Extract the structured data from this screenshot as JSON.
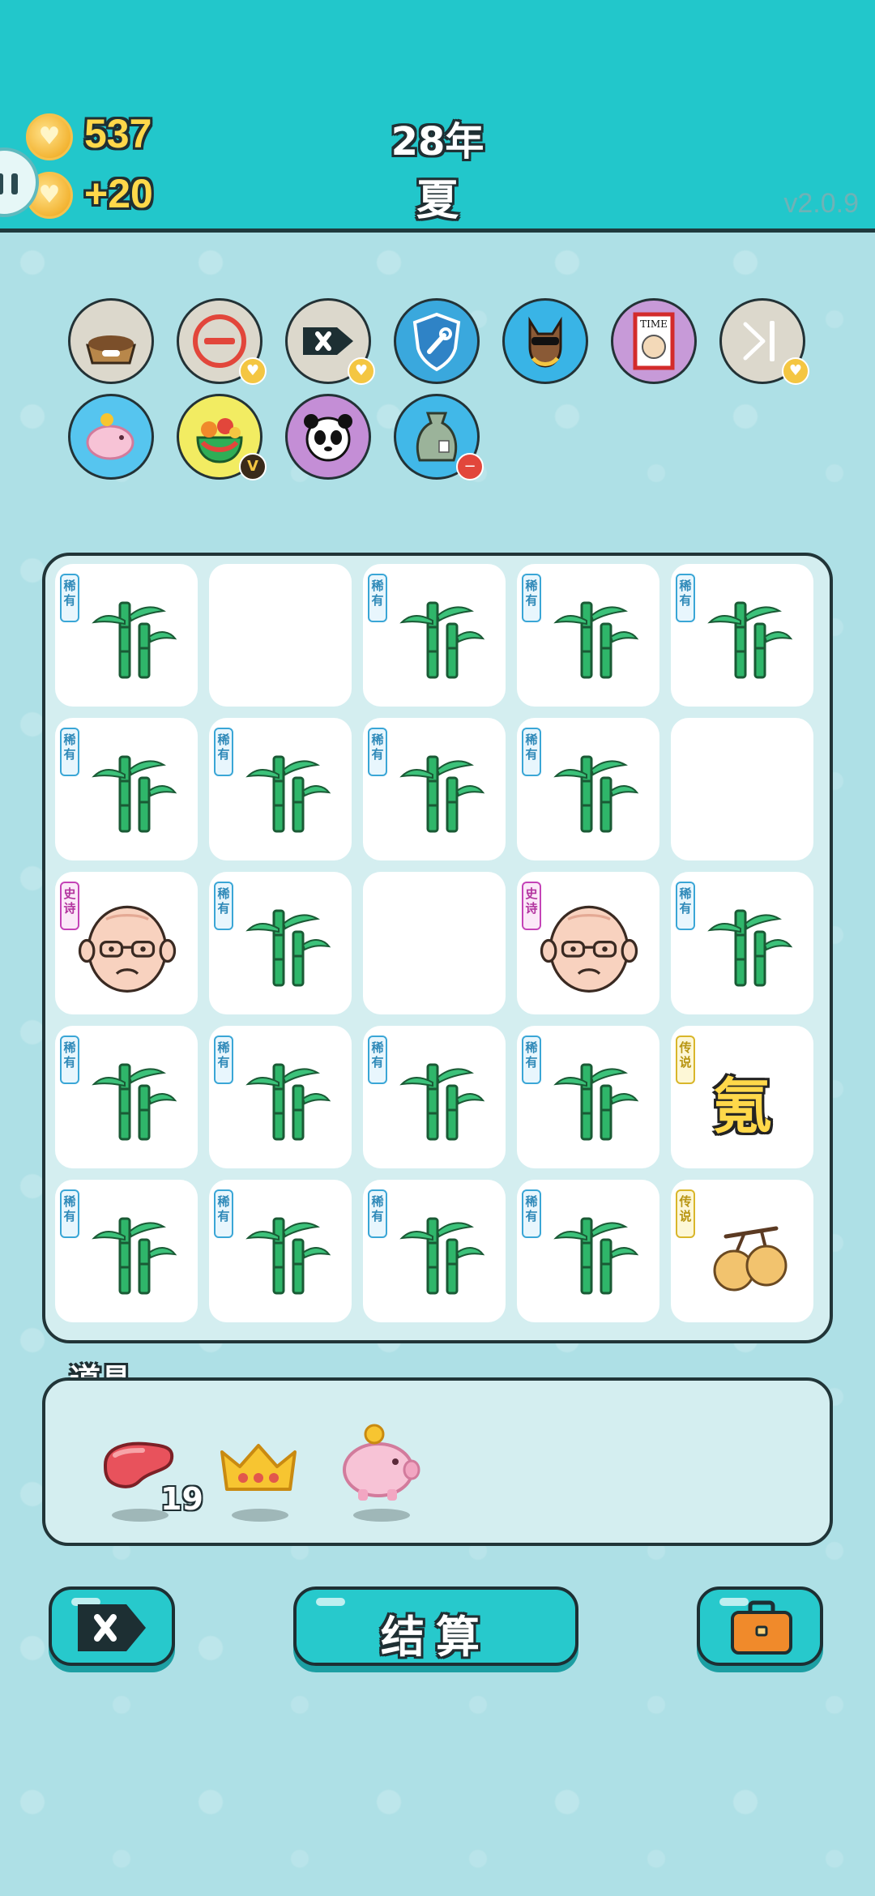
{
  "header": {
    "coins": "537",
    "income": "+20",
    "year": "28年",
    "season": "夏",
    "version": "v2.0.9"
  },
  "relics": [
    {
      "name": "pet-food-bowl-icon",
      "bg": "#dcd8cc"
    },
    {
      "name": "remove-token-icon",
      "bg": "#dcd8cc"
    },
    {
      "name": "delete-tag-icon",
      "bg": "#dcd8cc"
    },
    {
      "name": "shield-wrench-icon",
      "bg": "#3aa8dd"
    },
    {
      "name": "cool-dog-icon",
      "bg": "#39b4e6"
    },
    {
      "name": "time-magazine-icon",
      "bg": "#c79ad8"
    },
    {
      "name": "skip-icon",
      "bg": "#dcd8cc"
    },
    {
      "name": "piggy-bank-icon",
      "bg": "#56c5ef"
    },
    {
      "name": "fruit-basket-icon",
      "bg": "#f2ec62"
    },
    {
      "name": "panda-icon",
      "bg": "#c48ed6"
    },
    {
      "name": "sack-icon",
      "bg": "#41b8e8"
    }
  ],
  "rarity_labels": {
    "rare": "稀有",
    "epic": "史诗",
    "legend": "传说"
  },
  "grid": [
    [
      {
        "type": "bamboo",
        "rarity": "rare"
      },
      {
        "type": "empty"
      },
      {
        "type": "bamboo",
        "rarity": "rare"
      },
      {
        "type": "bamboo",
        "rarity": "rare"
      },
      {
        "type": "bamboo",
        "rarity": "rare"
      }
    ],
    [
      {
        "type": "bamboo",
        "rarity": "rare"
      },
      {
        "type": "bamboo",
        "rarity": "rare"
      },
      {
        "type": "bamboo",
        "rarity": "rare"
      },
      {
        "type": "bamboo",
        "rarity": "rare"
      },
      {
        "type": "empty"
      }
    ],
    [
      {
        "type": "old-man",
        "rarity": "epic"
      },
      {
        "type": "bamboo",
        "rarity": "rare"
      },
      {
        "type": "empty"
      },
      {
        "type": "old-man",
        "rarity": "epic"
      },
      {
        "type": "bamboo",
        "rarity": "rare"
      }
    ],
    [
      {
        "type": "bamboo",
        "rarity": "rare"
      },
      {
        "type": "bamboo",
        "rarity": "rare"
      },
      {
        "type": "bamboo",
        "rarity": "rare"
      },
      {
        "type": "bamboo",
        "rarity": "rare"
      },
      {
        "type": "krypton",
        "rarity": "legend",
        "text": "氪"
      }
    ],
    [
      {
        "type": "bamboo",
        "rarity": "rare"
      },
      {
        "type": "bamboo",
        "rarity": "rare"
      },
      {
        "type": "bamboo",
        "rarity": "rare"
      },
      {
        "type": "bamboo",
        "rarity": "rare"
      },
      {
        "type": "walnuts",
        "rarity": "legend"
      }
    ]
  ],
  "items": {
    "title": "道具",
    "list": [
      {
        "name": "liver-item",
        "count": "19"
      },
      {
        "name": "crown-item",
        "count": ""
      },
      {
        "name": "piggy-bank-item",
        "count": ""
      }
    ]
  },
  "buttons": {
    "remove": "remove-button",
    "settle": "结算",
    "bag": "briefcase-button"
  }
}
